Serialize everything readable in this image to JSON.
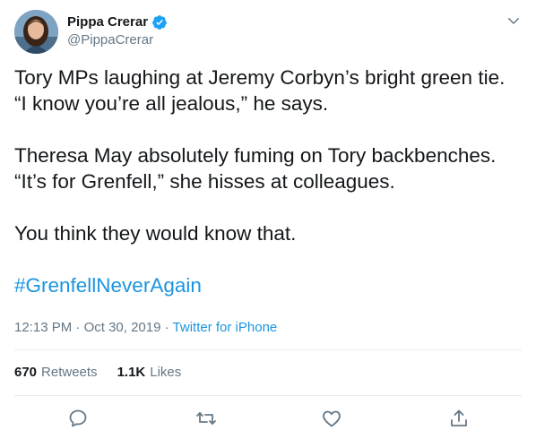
{
  "author": {
    "display_name": "Pippa Crerar",
    "handle": "@PippaCrerar",
    "verified": true
  },
  "tweet": {
    "paragraphs": [
      [
        "Tory MPs laughing at Jeremy Corbyn’s bright green tie.",
        "“I know you’re all jealous,” he says."
      ],
      [
        "Theresa May absolutely fuming on Tory backbenches.",
        "“It’s for Grenfell,” she hisses at colleagues."
      ],
      [
        "You think they would know that."
      ]
    ],
    "line_1": "Tory MPs laughing at Jeremy Corbyn’s bright green tie.",
    "line_2": "“I know you’re all jealous,” he says.",
    "line_3": "Theresa May absolutely fuming on Tory backbenches.",
    "line_4": "“It’s for Grenfell,” she hisses at colleagues.",
    "line_5": "You think they would know that.",
    "hashtag": "#GrenfellNeverAgain"
  },
  "meta": {
    "time": "12:13 PM",
    "separator": "·",
    "date": "Oct 30, 2019",
    "source": "Twitter for iPhone"
  },
  "stats": {
    "retweets_count": "670",
    "retweets_label": "Retweets",
    "likes_count": "1.1K",
    "likes_label": "Likes"
  },
  "colors": {
    "text": "#14171a",
    "secondary": "#657786",
    "link": "#1b95e0",
    "divider": "#e6ecf0",
    "verified": "#1da1f2"
  },
  "icons": {
    "reply": "reply-icon",
    "retweet": "retweet-icon",
    "like": "heart-icon",
    "share": "share-icon",
    "more": "chevron-down-icon",
    "verified": "verified-badge-icon"
  }
}
